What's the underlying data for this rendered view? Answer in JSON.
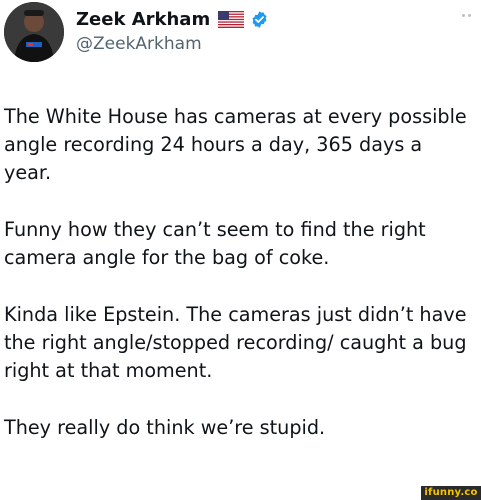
{
  "user": {
    "display_name": "Zeek Arkham",
    "handle": "@ZeekArkham",
    "flag_icon": "us-flag-icon",
    "verified_icon": "verified-badge-icon",
    "verified_color": "#1d9bf0"
  },
  "tweet": {
    "paragraphs": [
      "The White House has cameras at every possible angle recording 24 hours a day, 365 days a year.",
      "Funny how they can’t seem to find the right camera angle for the bag of coke.",
      "Kinda like Epstein. The cameras just didn’t have the right angle/stopped recording/ caught a bug right at that moment.",
      "They really do think we’re stupid."
    ]
  },
  "watermark": {
    "text": "ifunny.co",
    "color": "#f5c400"
  }
}
